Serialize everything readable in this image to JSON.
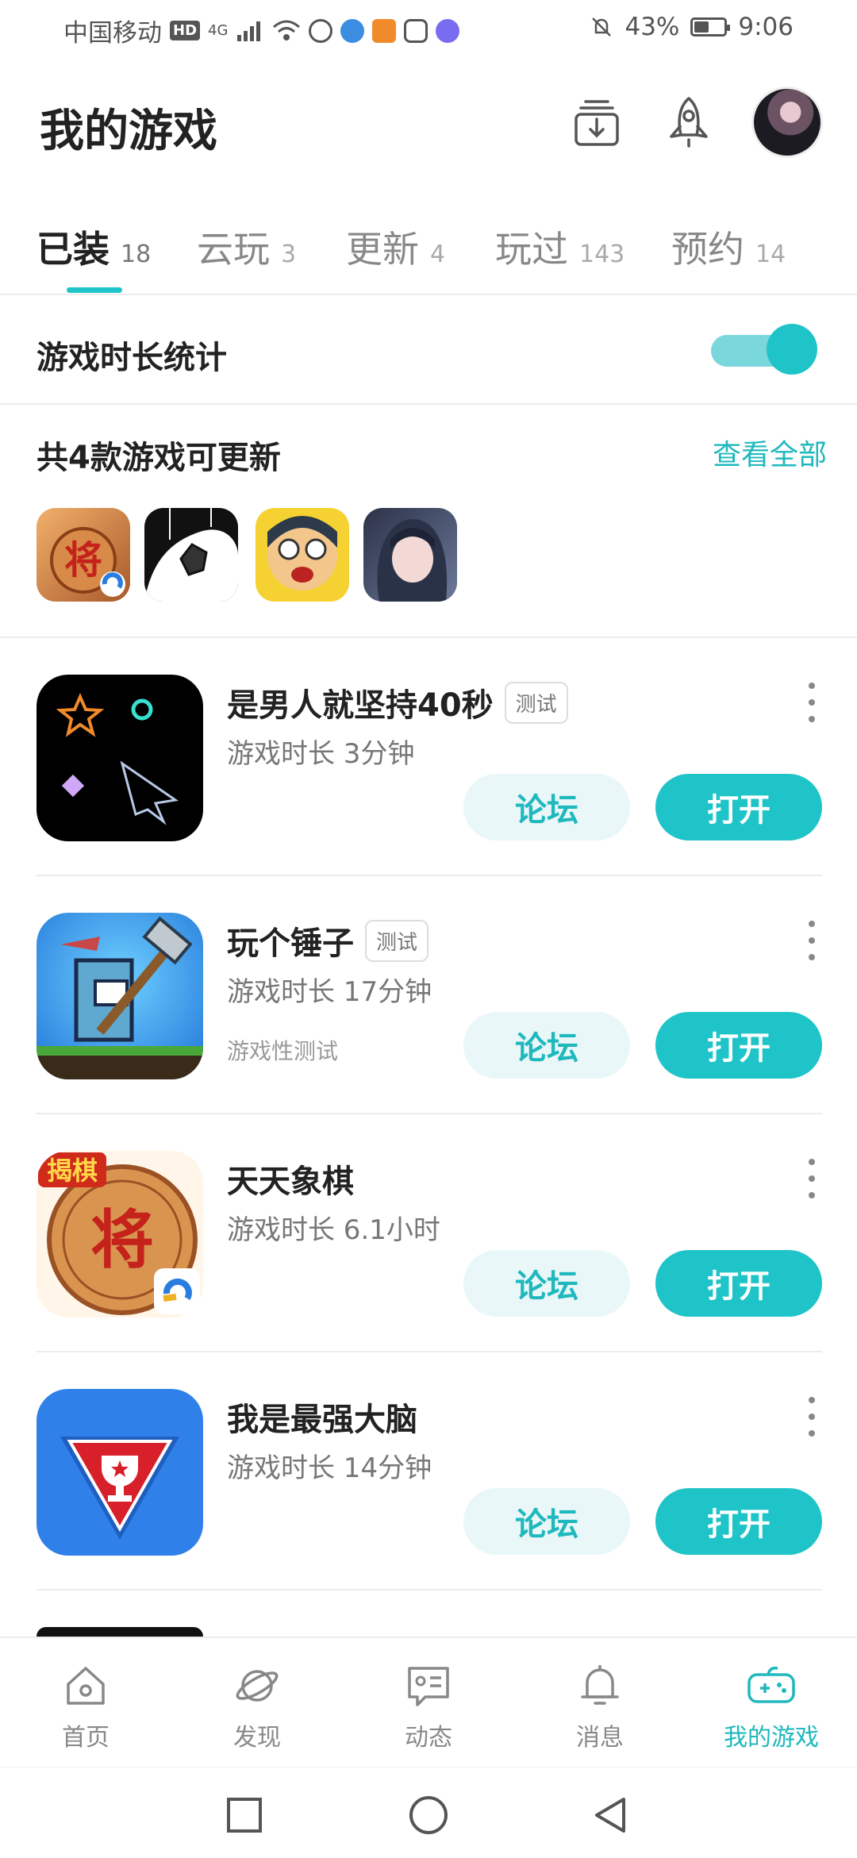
{
  "status_bar": {
    "carrier": "中国移动",
    "hd": "HD",
    "network": "4G",
    "battery_percent": "43%",
    "battery_level": 0.43,
    "time": "9:06"
  },
  "header": {
    "title": "我的游戏"
  },
  "tabs": [
    {
      "label": "已装",
      "count": "18",
      "active": true
    },
    {
      "label": "云玩",
      "count": "3"
    },
    {
      "label": "更新",
      "count": "4"
    },
    {
      "label": "玩过",
      "count": "143"
    },
    {
      "label": "预约",
      "count": "14"
    }
  ],
  "stats_toggle": {
    "label": "游戏时长统计",
    "on": true
  },
  "updates": {
    "title": "共4款游戏可更新",
    "see_all": "查看全部",
    "icons": [
      "chinese-chess-icon",
      "soccer-player-icon",
      "cartoon-boy-icon",
      "anime-girl-icon"
    ]
  },
  "games": [
    {
      "name": "是男人就坚持40秒",
      "badge": "测试",
      "time": "游戏时长 3分钟",
      "extra": "",
      "forum": "论坛",
      "open": "打开"
    },
    {
      "name": "玩个锤子",
      "badge": "测试",
      "time": "游戏时长 17分钟",
      "extra": "游戏性测试",
      "forum": "论坛",
      "open": "打开"
    },
    {
      "name": "天天象棋",
      "badge": "",
      "time": "游戏时长 6.1小时",
      "extra": "",
      "forum": "论坛",
      "open": "打开",
      "icon_text": "揭棋",
      "icon_char": "将"
    },
    {
      "name": "我是最强大脑",
      "badge": "",
      "time": "游戏时长 14分钟",
      "extra": "",
      "forum": "论坛",
      "open": "打开"
    }
  ],
  "bottom_nav": [
    {
      "label": "首页",
      "icon": "home-icon"
    },
    {
      "label": "发现",
      "icon": "planet-icon"
    },
    {
      "label": "动态",
      "icon": "feed-icon"
    },
    {
      "label": "消息",
      "icon": "bell-icon"
    },
    {
      "label": "我的游戏",
      "icon": "gamepad-icon",
      "active": true
    }
  ],
  "colors": {
    "accent": "#1fc4c8",
    "accent_light": "#eaf7f8"
  }
}
